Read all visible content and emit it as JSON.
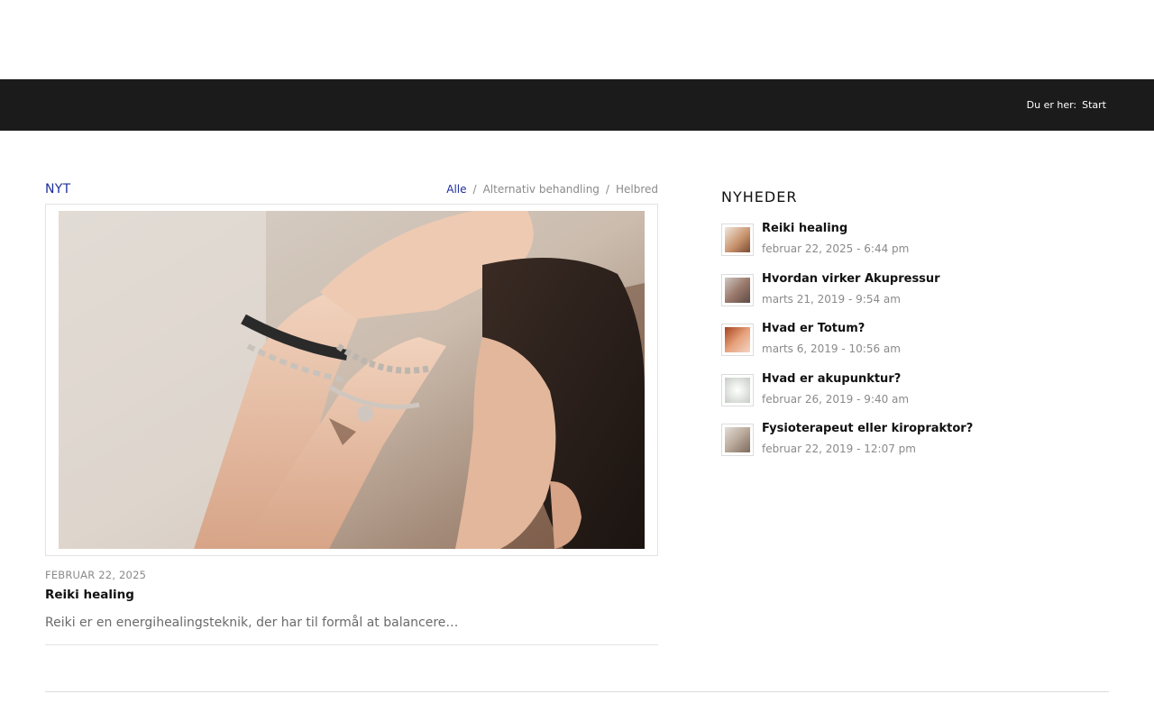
{
  "breadcrumb": {
    "prefix": "Du er her:",
    "current": "Start"
  },
  "grid": {
    "title": "NYT",
    "filters": [
      {
        "label": "Alle",
        "active": true
      },
      {
        "label": "Alternativ behandling",
        "active": false
      },
      {
        "label": "Helbred",
        "active": false
      }
    ],
    "separator": "/",
    "post": {
      "image": "woman-hands-bracelets-photo",
      "date": "FEBRUAR 22, 2025",
      "title": "Reiki healing",
      "excerpt": "Reiki er en energihealingsteknik, der har til formål at balancere…"
    }
  },
  "sidebar": {
    "title": "NYHEDER",
    "items": [
      {
        "title": "Reiki healing",
        "date": "februar 22, 2025 - 6:44 pm"
      },
      {
        "title": "Hvordan virker Akupressur",
        "date": "marts 21, 2019 - 9:54 am"
      },
      {
        "title": "Hvad er Totum?",
        "date": "marts 6, 2019 - 10:56 am"
      },
      {
        "title": "Hvad er akupunktur?",
        "date": "februar 26, 2019 - 9:40 am"
      },
      {
        "title": "Fysioterapeut eller kiropraktor?",
        "date": "februar 22, 2019 - 12:07 pm"
      }
    ]
  },
  "colors": {
    "accent": "#1e2e9e",
    "header_bar": "#1b1b1b"
  }
}
